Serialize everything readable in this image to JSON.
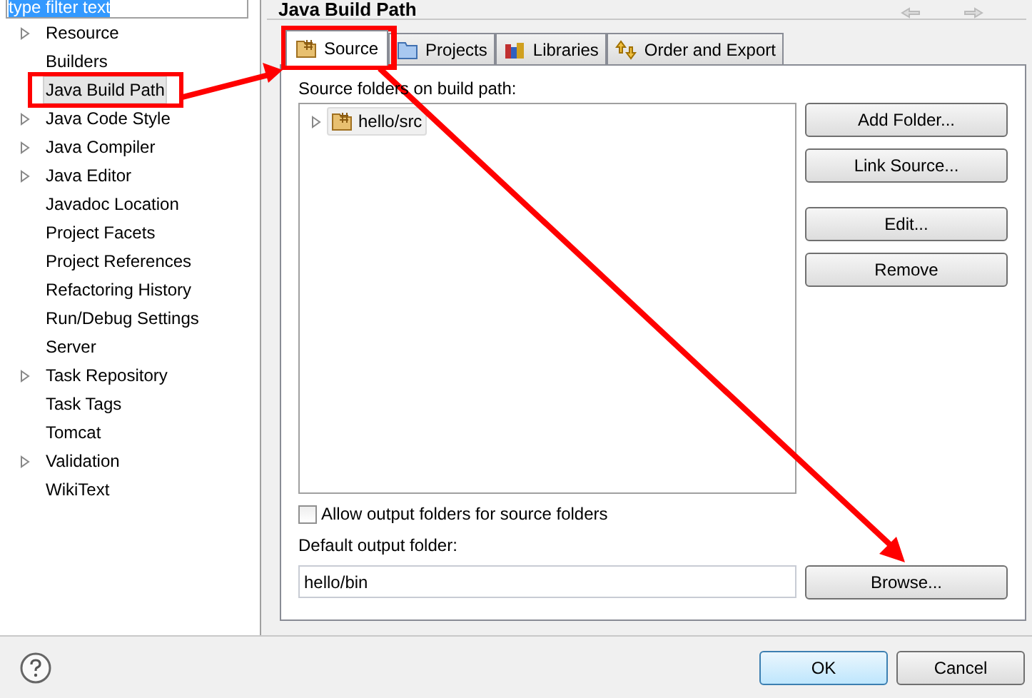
{
  "filter": {
    "value": "type filter text"
  },
  "sidebar": {
    "items": [
      {
        "label": "Resource",
        "expandable": true,
        "selected": false
      },
      {
        "label": "Builders",
        "expandable": false,
        "selected": false
      },
      {
        "label": "Java Build Path",
        "expandable": false,
        "selected": true
      },
      {
        "label": "Java Code Style",
        "expandable": true,
        "selected": false
      },
      {
        "label": "Java Compiler",
        "expandable": true,
        "selected": false
      },
      {
        "label": "Java Editor",
        "expandable": true,
        "selected": false
      },
      {
        "label": "Javadoc Location",
        "expandable": false,
        "selected": false
      },
      {
        "label": "Project Facets",
        "expandable": false,
        "selected": false
      },
      {
        "label": "Project References",
        "expandable": false,
        "selected": false
      },
      {
        "label": "Refactoring History",
        "expandable": false,
        "selected": false
      },
      {
        "label": "Run/Debug Settings",
        "expandable": false,
        "selected": false
      },
      {
        "label": "Server",
        "expandable": false,
        "selected": false
      },
      {
        "label": "Task Repository",
        "expandable": true,
        "selected": false
      },
      {
        "label": "Task Tags",
        "expandable": false,
        "selected": false
      },
      {
        "label": "Tomcat",
        "expandable": false,
        "selected": false
      },
      {
        "label": "Validation",
        "expandable": true,
        "selected": false
      },
      {
        "label": "WikiText",
        "expandable": false,
        "selected": false
      }
    ]
  },
  "page": {
    "title": "Java Build Path"
  },
  "tabs": [
    {
      "label": "Source",
      "kind": "source",
      "selected": true
    },
    {
      "label": "Projects",
      "kind": "projects",
      "selected": false
    },
    {
      "label": "Libraries",
      "kind": "libraries",
      "selected": false
    },
    {
      "label": "Order and Export",
      "kind": "order",
      "selected": false
    }
  ],
  "source_label": "Source folders on build path:",
  "source_tree": [
    {
      "label": "hello/src",
      "expanded": false
    }
  ],
  "button_groups": [
    {
      "buttons": [
        "Add Folder...",
        "Link Source..."
      ]
    },
    {
      "buttons": [
        "Edit...",
        "Remove"
      ]
    }
  ],
  "allow_output": {
    "label": "Allow output folders for source folders",
    "checked": false
  },
  "output_label": "Default output folder:",
  "output_field": {
    "value": "hello/bin"
  },
  "browse_button": "Browse...",
  "footer_buttons": [
    {
      "label": "OK",
      "default": true
    },
    {
      "label": "Cancel",
      "default": false
    }
  ]
}
